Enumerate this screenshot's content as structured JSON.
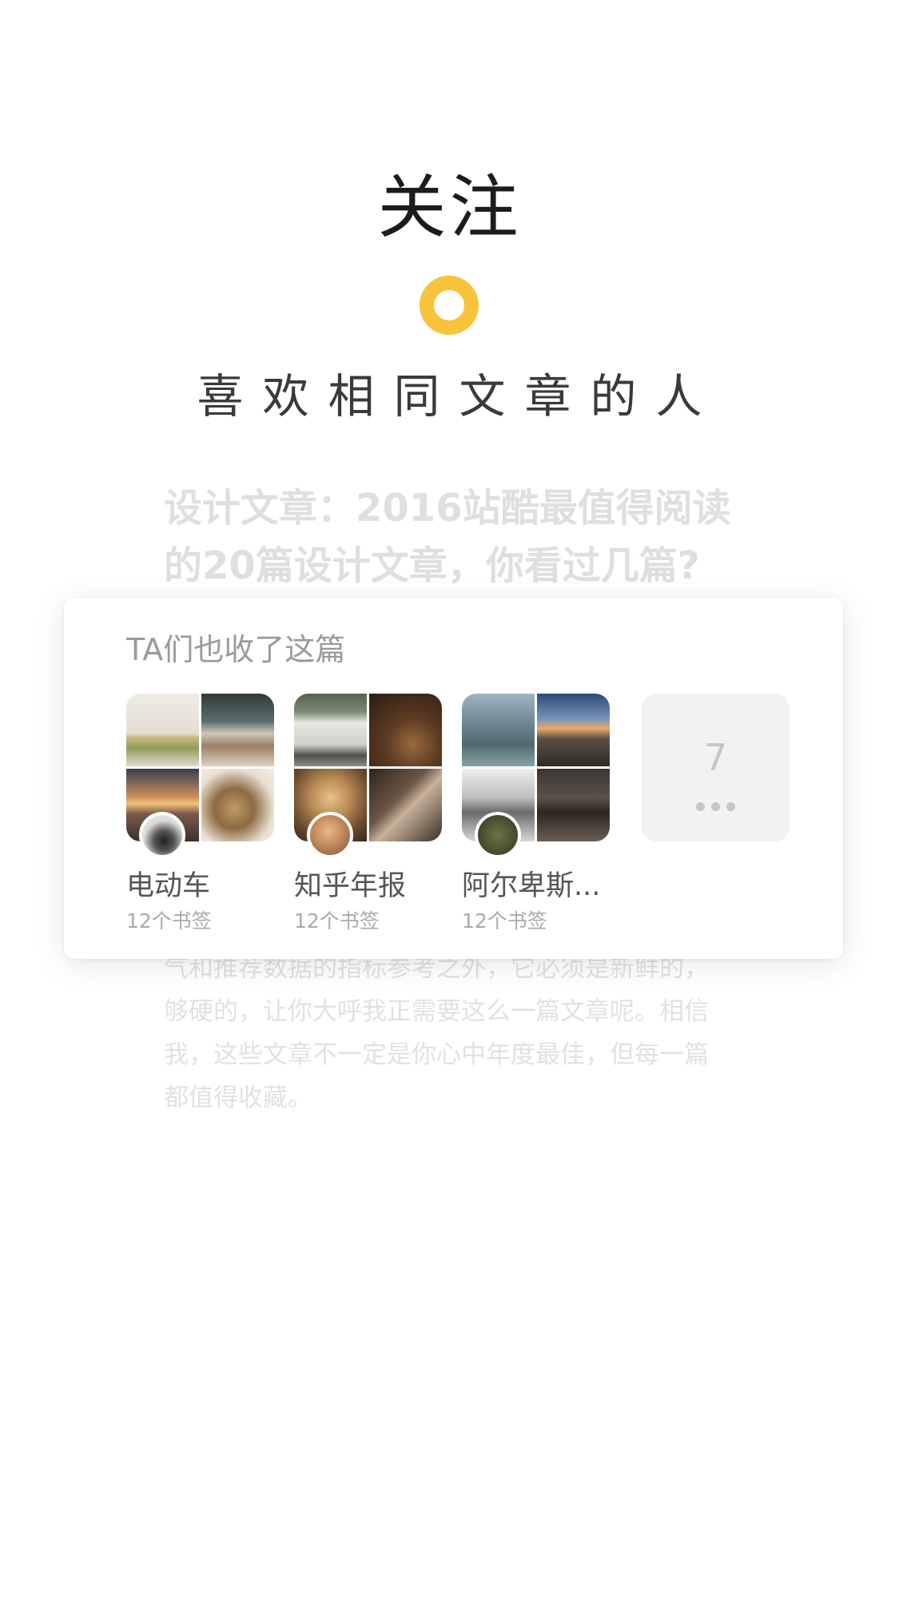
{
  "onboarding": {
    "title": "关注",
    "subtitle": "喜欢相同文章的人"
  },
  "background_article": {
    "headline_line1": "设计文章：2016站酷最值得阅读",
    "headline_line2": "的20篇设计文章，你看过几篇?",
    "body_lines": [
      "气和推荐数据的指标参考之外，它必须是新鲜的，",
      "够硬的，让你大呼我正需要这么一篇文章呢。相信",
      "我，这些文章不一定是你心中年度最佳，但每一篇",
      "都值得收藏。"
    ]
  },
  "card": {
    "header": "TA们也收了这篇",
    "collections": [
      {
        "name": "电动车",
        "count": "12个书签"
      },
      {
        "name": "知乎年报",
        "count": "12个书签"
      },
      {
        "name": "阿尔卑斯...",
        "count": "12个书签"
      }
    ],
    "more": {
      "count": "7",
      "icon": "more-dots-icon"
    }
  },
  "colors": {
    "accent": "#f8c23a",
    "card_header": "#9a9a9a",
    "collection_name": "#555555",
    "collection_count": "#aaaaaa",
    "more_tile_bg": "#f2f2f2"
  }
}
